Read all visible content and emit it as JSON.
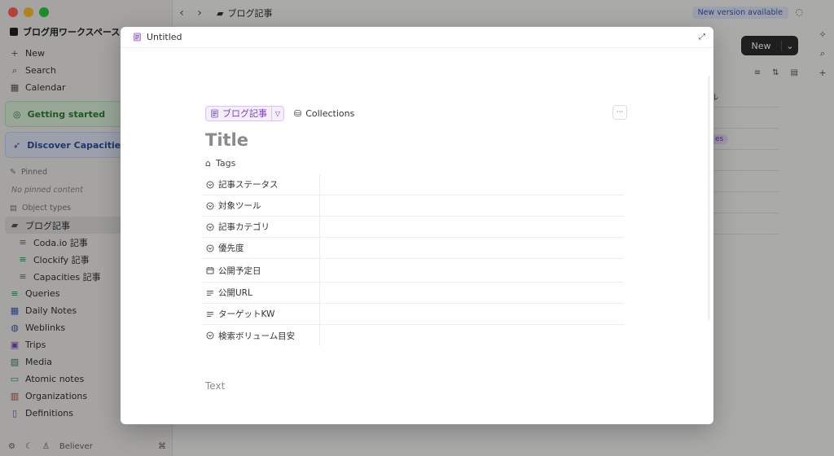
{
  "window": {
    "workspace": "ブログ用ワークスペース",
    "breadcrumb_title": "ブログ記事",
    "new_version": "New version available",
    "traffic": {
      "close": "#ff5f57",
      "min": "#febc2e",
      "max": "#28c840"
    }
  },
  "sidebar": {
    "top_items": [
      {
        "icon": "plus-icon",
        "label": "New"
      },
      {
        "icon": "search-icon",
        "label": "Search"
      },
      {
        "icon": "calendar-icon",
        "label": "Calendar"
      }
    ],
    "getting_started": "Getting started",
    "discover": "Discover Capacities Pro",
    "pinned_heading": "Pinned",
    "no_pinned": "No pinned content",
    "object_types_heading": "Object types",
    "object_types": [
      {
        "label": "ブログ記事",
        "active": true,
        "sub": false
      },
      {
        "label": "Coda.io 記事",
        "sub": true
      },
      {
        "label": "Clockify 記事",
        "sub": true
      },
      {
        "label": "Capacities 記事",
        "sub": true
      },
      {
        "label": "Queries",
        "sub": false
      },
      {
        "label": "Daily Notes",
        "sub": false
      },
      {
        "label": "Weblinks",
        "sub": false
      },
      {
        "label": "Trips",
        "sub": false
      },
      {
        "label": "Media",
        "sub": false
      },
      {
        "label": "Atomic notes",
        "sub": false
      },
      {
        "label": "Organizations",
        "sub": false
      },
      {
        "label": "Definitions",
        "sub": false
      }
    ],
    "footer_user": "Believer",
    "footer_shortcut": "⌘"
  },
  "background": {
    "new_button": "New",
    "table_header": "ル",
    "pill": "es"
  },
  "modal": {
    "header_title": "Untitled",
    "type_label": "ブログ記事",
    "collections_label": "Collections",
    "more_label": "···",
    "title_placeholder": "Title",
    "tags_label": "Tags",
    "properties": [
      {
        "icon": "select-icon",
        "label": "記事ステータス"
      },
      {
        "icon": "select-icon",
        "label": "対象ツール"
      },
      {
        "icon": "select-icon",
        "label": "記事カテゴリ"
      },
      {
        "icon": "select-icon",
        "label": "優先度"
      },
      {
        "icon": "date-icon",
        "label": "公開予定日",
        "tall": true
      },
      {
        "icon": "text-icon",
        "label": "公開URL"
      },
      {
        "icon": "text-icon",
        "label": "ターゲットKW"
      },
      {
        "icon": "select-icon",
        "label": "検索ボリューム目安"
      }
    ],
    "text_placeholder": "Text"
  },
  "colors": {
    "accent_purple": "#7b3fb4",
    "chip_bg": "#f5eefc",
    "green_card": "#dbefdc",
    "blue_card": "#dfe6f7"
  }
}
